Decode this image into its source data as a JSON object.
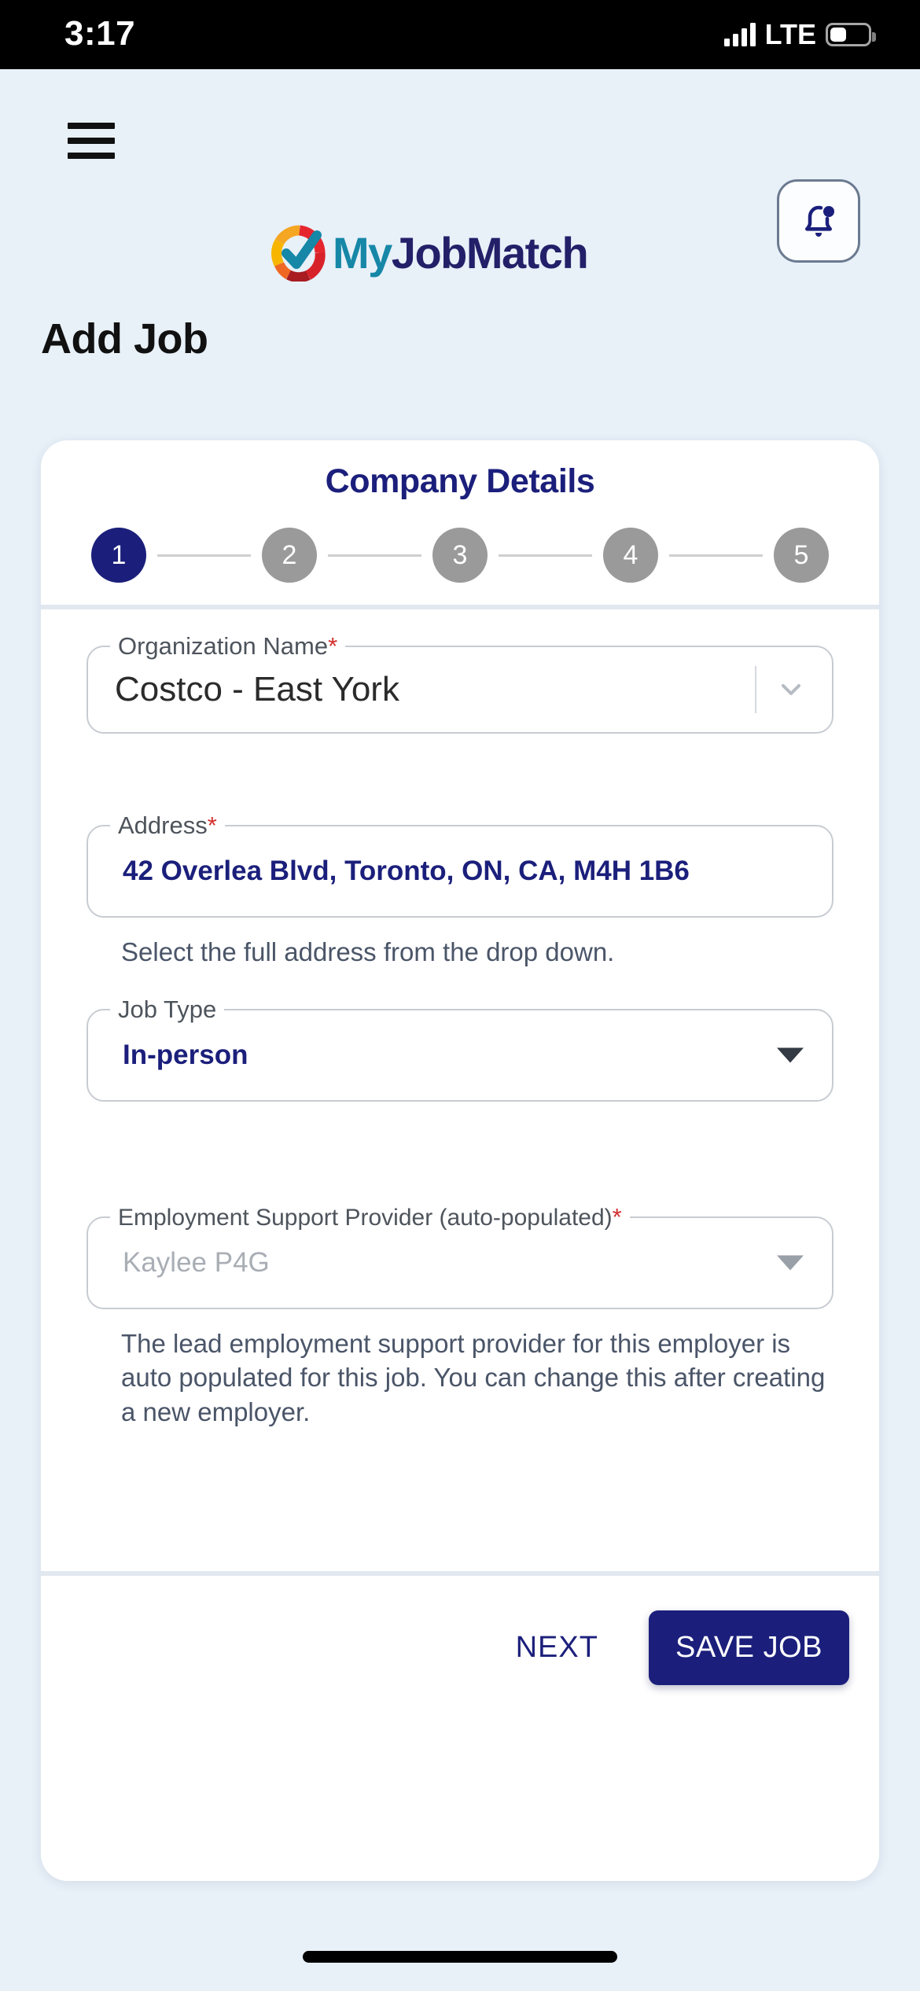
{
  "status_bar": {
    "time": "3:17",
    "network": "LTE",
    "signal_icon": "signal-bars-icon",
    "battery_icon": "battery-icon"
  },
  "header": {
    "menu_icon": "hamburger-menu-icon",
    "logo_prefix": "My",
    "logo_suffix": "JobMatch",
    "logo_mark_icon": "checkmark-circle-logo-icon",
    "notification_icon": "bell-notification-icon"
  },
  "page": {
    "title": "Add Job"
  },
  "card": {
    "title": "Company Details",
    "stepper": {
      "steps": [
        {
          "label": "1",
          "state": "active"
        },
        {
          "label": "2",
          "state": "idle"
        },
        {
          "label": "3",
          "state": "idle"
        },
        {
          "label": "4",
          "state": "idle"
        },
        {
          "label": "5",
          "state": "idle"
        }
      ],
      "active_color": "#1b1f7b",
      "idle_color": "#9a9a9a"
    },
    "fields": {
      "organization": {
        "label": "Organization Name",
        "required_marker": "*",
        "value": "Costco - East York",
        "dropdown_icon": "chevron-down-icon"
      },
      "address": {
        "label": "Address",
        "required_marker": "*",
        "value": "42 Overlea Blvd, Toronto, ON, CA, M4H 1B6",
        "helper": "Select the full address from the drop down."
      },
      "job_type": {
        "label": "Job Type",
        "value": "In-person",
        "dropdown_icon": "caret-down-icon"
      },
      "support_provider": {
        "label": "Employment Support Provider (auto-populated)",
        "required_marker": "*",
        "value": "Kaylee P4G",
        "dropdown_icon": "caret-down-icon",
        "helper": "The lead employment support provider for this employer is auto populated for this job. You can change this after creating a new employer."
      }
    },
    "footer": {
      "next_label": "NEXT",
      "save_label": "SAVE JOB"
    }
  },
  "theme": {
    "background": "#e8f0f8",
    "brand_navy": "#1b1f7b",
    "brand_teal": "#1687a7",
    "required_red": "#d32f2f",
    "muted_text": "#4a5568"
  }
}
